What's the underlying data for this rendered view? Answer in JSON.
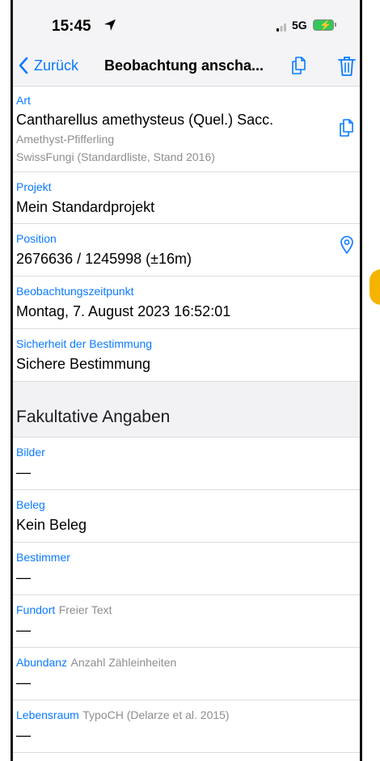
{
  "status": {
    "time": "15:45",
    "network": "5G"
  },
  "nav": {
    "back_label": "Zurück",
    "title": "Beobachtung anscha..."
  },
  "art": {
    "label": "Art",
    "name": "Cantharellus amethysteus (Quel.) Sacc.",
    "common": "Amethyst-Pfifferling",
    "source": "SwissFungi (Standardliste, Stand 2016)"
  },
  "projekt": {
    "label": "Projekt",
    "value": "Mein Standardprojekt"
  },
  "position": {
    "label": "Position",
    "value": "2676636 / 1245998 (±16m)"
  },
  "zeitpunkt": {
    "label": "Beobachtungszeitpunkt",
    "value": "Montag, 7. August 2023 16:52:01"
  },
  "sicherheit": {
    "label": "Sicherheit der Bestimmung",
    "value": "Sichere Bestimmung"
  },
  "section_title": "Fakultative Angaben",
  "optional": [
    {
      "label": "Bilder",
      "hint": "",
      "value": "—"
    },
    {
      "label": "Beleg",
      "hint": "",
      "value": "Kein Beleg"
    },
    {
      "label": "Bestimmer",
      "hint": "",
      "value": "—"
    },
    {
      "label": "Fundort",
      "hint": "Freier Text",
      "value": "—"
    },
    {
      "label": "Abundanz",
      "hint": "Anzahl Zähleinheiten",
      "value": "—"
    },
    {
      "label": "Lebensraum",
      "hint": "TypoCH (Delarze et al. 2015)",
      "value": "—"
    }
  ],
  "colors": {
    "accent": "#0a7aff",
    "secondary": "#8e8e93",
    "section_bg": "#f2f2f4"
  }
}
